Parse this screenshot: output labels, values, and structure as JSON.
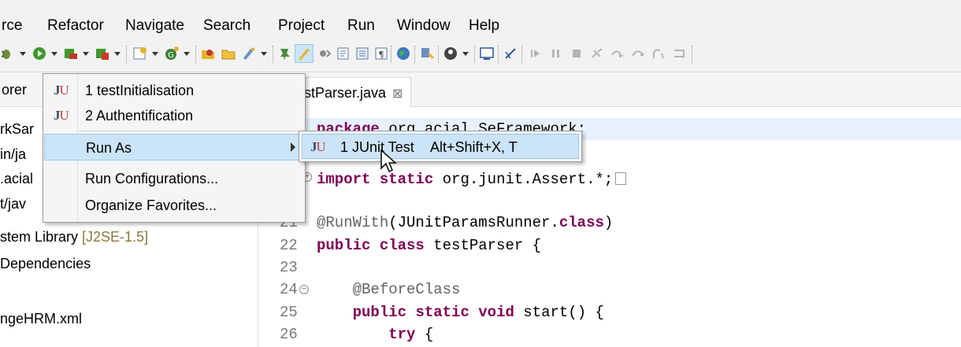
{
  "menubar": {
    "items": [
      {
        "label": "rce"
      },
      {
        "label": "Refactor"
      },
      {
        "label": "Navigate"
      },
      {
        "label": "Search"
      },
      {
        "label": "Project"
      },
      {
        "label": "Run"
      },
      {
        "label": "Window"
      },
      {
        "label": "Help"
      }
    ]
  },
  "toolbar": {
    "icons": [
      "debug-icon",
      "run-icon",
      "coverage-icon",
      "external-tools-icon",
      "new-wizard-icon",
      "new-class-icon",
      "open-type-icon",
      "open-folder-icon",
      "search-icon",
      "pin-icon",
      "highlight-icon",
      "skip-all-breakpoints-icon",
      "toggle-mark-occurrences-icon",
      "block-selection-icon",
      "show-whitespace-icon",
      "globe-icon",
      "servers-icon",
      "remote-icon",
      "console-icon",
      "remove-icon",
      "resume-icon",
      "suspend-icon",
      "terminate-icon",
      "disconnect-icon",
      "step-into-icon",
      "step-over-icon",
      "step-return-icon",
      "drop-to-frame-icon"
    ]
  },
  "explorer": {
    "tab_label": "orer",
    "lines": [
      {
        "text": "rkSar"
      },
      {
        "text": "in/ja"
      },
      {
        "text": ".acial"
      },
      {
        "text": "t/jav"
      },
      {
        "text": "stem Library ",
        "suffix": "[J2SE-1.5]"
      },
      {
        "text": " Dependencies"
      },
      {
        "text": "ngeHRM.xml"
      }
    ]
  },
  "editor": {
    "tab_label": "stParser.java",
    "tab_close": "⊠",
    "lines": [
      {
        "num": "",
        "parts": [
          {
            "t": "package",
            "c": "kw"
          },
          {
            "t": " org.acial.SeFramework;",
            "c": ""
          }
        ]
      },
      {
        "num": "",
        "parts": [
          {
            "t": "import",
            "c": "kw"
          },
          {
            "t": " ",
            "c": ""
          },
          {
            "t": "static",
            "c": "kw"
          },
          {
            "t": " org.junit.Assert.*;",
            "c": ""
          }
        ]
      },
      {
        "num": "21",
        "parts": [
          {
            "t": "@RunWith",
            "c": "ann"
          },
          {
            "t": "(JUnitParamsRunner.",
            "c": ""
          },
          {
            "t": "class",
            "c": "kw"
          },
          {
            "t": ")",
            "c": ""
          }
        ]
      },
      {
        "num": "22",
        "parts": [
          {
            "t": "public",
            "c": "kw"
          },
          {
            "t": " ",
            "c": ""
          },
          {
            "t": "class",
            "c": "kw"
          },
          {
            "t": " testParser {",
            "c": ""
          }
        ]
      },
      {
        "num": "23",
        "parts": [
          {
            "t": "",
            "c": ""
          }
        ]
      },
      {
        "num": "24",
        "parts": [
          {
            "t": "    @BeforeClass",
            "c": "ann"
          }
        ]
      },
      {
        "num": "25",
        "parts": [
          {
            "t": "    ",
            "c": ""
          },
          {
            "t": "public",
            "c": "kw"
          },
          {
            "t": " ",
            "c": ""
          },
          {
            "t": "static",
            "c": "kw"
          },
          {
            "t": " ",
            "c": ""
          },
          {
            "t": "void",
            "c": "kw"
          },
          {
            "t": " start() {",
            "c": ""
          }
        ]
      },
      {
        "num": "26",
        "parts": [
          {
            "t": "        ",
            "c": ""
          },
          {
            "t": "try",
            "c": "kw"
          },
          {
            "t": " {",
            "c": ""
          }
        ]
      }
    ]
  },
  "run_menu": {
    "items": [
      {
        "label": "1 testInitialisation",
        "icon": "junit-icon"
      },
      {
        "label": "2 Authentification",
        "icon": "junit-icon"
      },
      {
        "label": "Run As",
        "highlighted": true,
        "has_submenu": true
      },
      {
        "label": "Run Configurations..."
      },
      {
        "label": "Organize Favorites..."
      }
    ]
  },
  "run_as_submenu": {
    "label": "1 JUnit Test",
    "accelerator": "Alt+Shift+X, T",
    "icon": "junit-icon"
  },
  "colors": {
    "highlight": "#cce4f7",
    "keyword": "#7f0055",
    "annotation": "#646464",
    "current_line": "#e8f2fe"
  }
}
